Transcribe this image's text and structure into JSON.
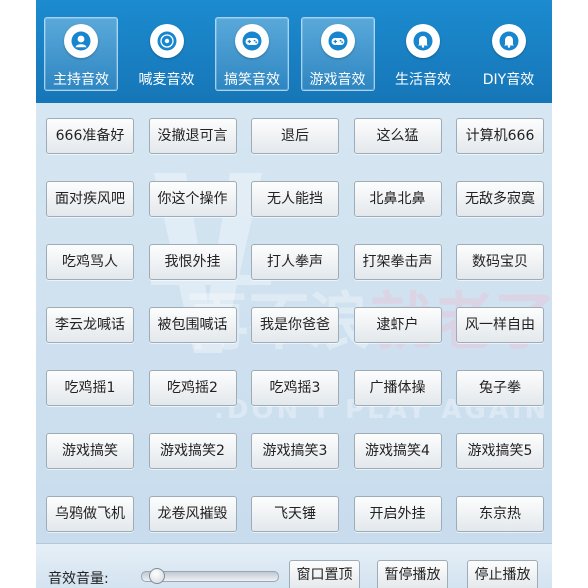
{
  "tabs": [
    {
      "label": "主持音效",
      "icon": "person-icon",
      "active": true
    },
    {
      "label": "喊麦音效",
      "icon": "vinyl-disc-icon",
      "active": false
    },
    {
      "label": "搞笑音效",
      "icon": "gamepad-icon",
      "active": true
    },
    {
      "label": "游戏音效",
      "icon": "gamepad-icon",
      "active": true
    },
    {
      "label": "生活音效",
      "icon": "bell-icon",
      "active": false
    },
    {
      "label": "DIY音效",
      "icon": "bell-icon",
      "active": false
    }
  ],
  "sounds": [
    [
      "666准备好",
      "没撤退可言",
      "退后",
      "这么猛",
      "计算机666"
    ],
    [
      "面对疾风吧",
      "你这个操作",
      "无人能挡",
      "北鼻北鼻",
      "无敌多寂寞"
    ],
    [
      "吃鸡骂人",
      "我恨外挂",
      "打人拳声",
      "打架拳击声",
      "数码宝贝"
    ],
    [
      "李云龙喊话",
      "被包围喊话",
      "我是你爸爸",
      "逮虾户",
      "风一样自由"
    ],
    [
      "吃鸡摇1",
      "吃鸡摇2",
      "吃鸡摇3",
      "广播体操",
      "兔子拳"
    ],
    [
      "游戏搞笑",
      "游戏搞笑2",
      "游戏搞笑3",
      "游戏搞笑4",
      "游戏搞笑5"
    ],
    [
      "乌鸦做飞机",
      "龙卷风摧毁",
      "飞天锤",
      "开启外挂",
      "东京热"
    ]
  ],
  "bottom": {
    "volume_label": "音效音量:",
    "volume_level": 0.05,
    "buttons": [
      "窗口置顶",
      "暂停播放",
      "停止播放"
    ]
  },
  "colors": {
    "tabbar": "#1a82c4",
    "icon_blue": "#1786cf"
  }
}
